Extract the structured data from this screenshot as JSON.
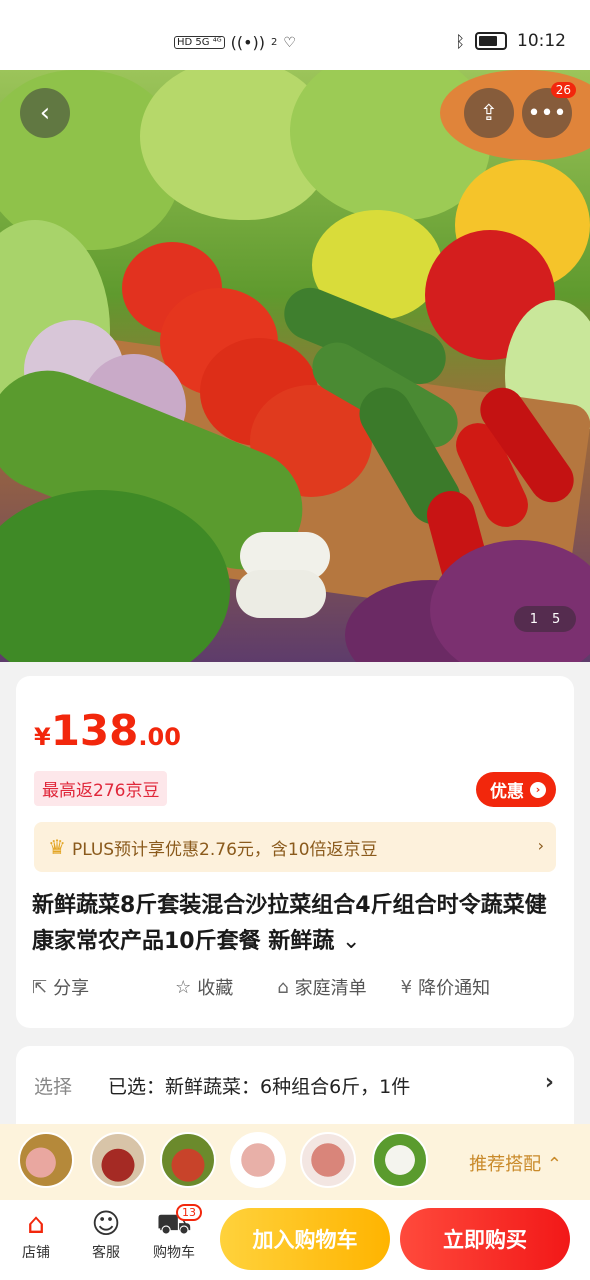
{
  "status_bar": {
    "time": "10:12",
    "indicators": "HD  5G  ⁴ᴳ",
    "wifi_count": "2"
  },
  "hero": {
    "more_badge": "26",
    "pager_current": "1",
    "pager_total": "5",
    "icons": {
      "back": "back-arrow-icon",
      "share": "share-icon",
      "more": "more-icon"
    }
  },
  "price": {
    "symbol": "¥",
    "integer": "138",
    "decimal": ".00",
    "beans_text": "最高返276京豆",
    "coupon_label": "优惠",
    "plus_text": "PLUS预计享优惠2.76元，含10倍返京豆"
  },
  "product": {
    "title": "新鲜蔬菜8斤套装混合沙拉菜组合4斤组合时令蔬菜健康家常农产品10斤套餐 新鲜蔬"
  },
  "actions": [
    {
      "label": "分享",
      "icon": "share-icon"
    },
    {
      "label": "收藏",
      "icon": "star-icon"
    },
    {
      "label": "家庭清单",
      "icon": "home-icon"
    },
    {
      "label": "降价通知",
      "icon": "yen-icon"
    }
  ],
  "selection": {
    "label": "选择",
    "value": "已选：新鲜蔬菜：6种组合6斤，1件"
  },
  "combo": {
    "label": "推荐搭配"
  },
  "bottom": {
    "store": "店铺",
    "service": "客服",
    "cart": "购物车",
    "cart_count": "13",
    "add_cart": "加入购物车",
    "buy_now": "立即购买"
  }
}
